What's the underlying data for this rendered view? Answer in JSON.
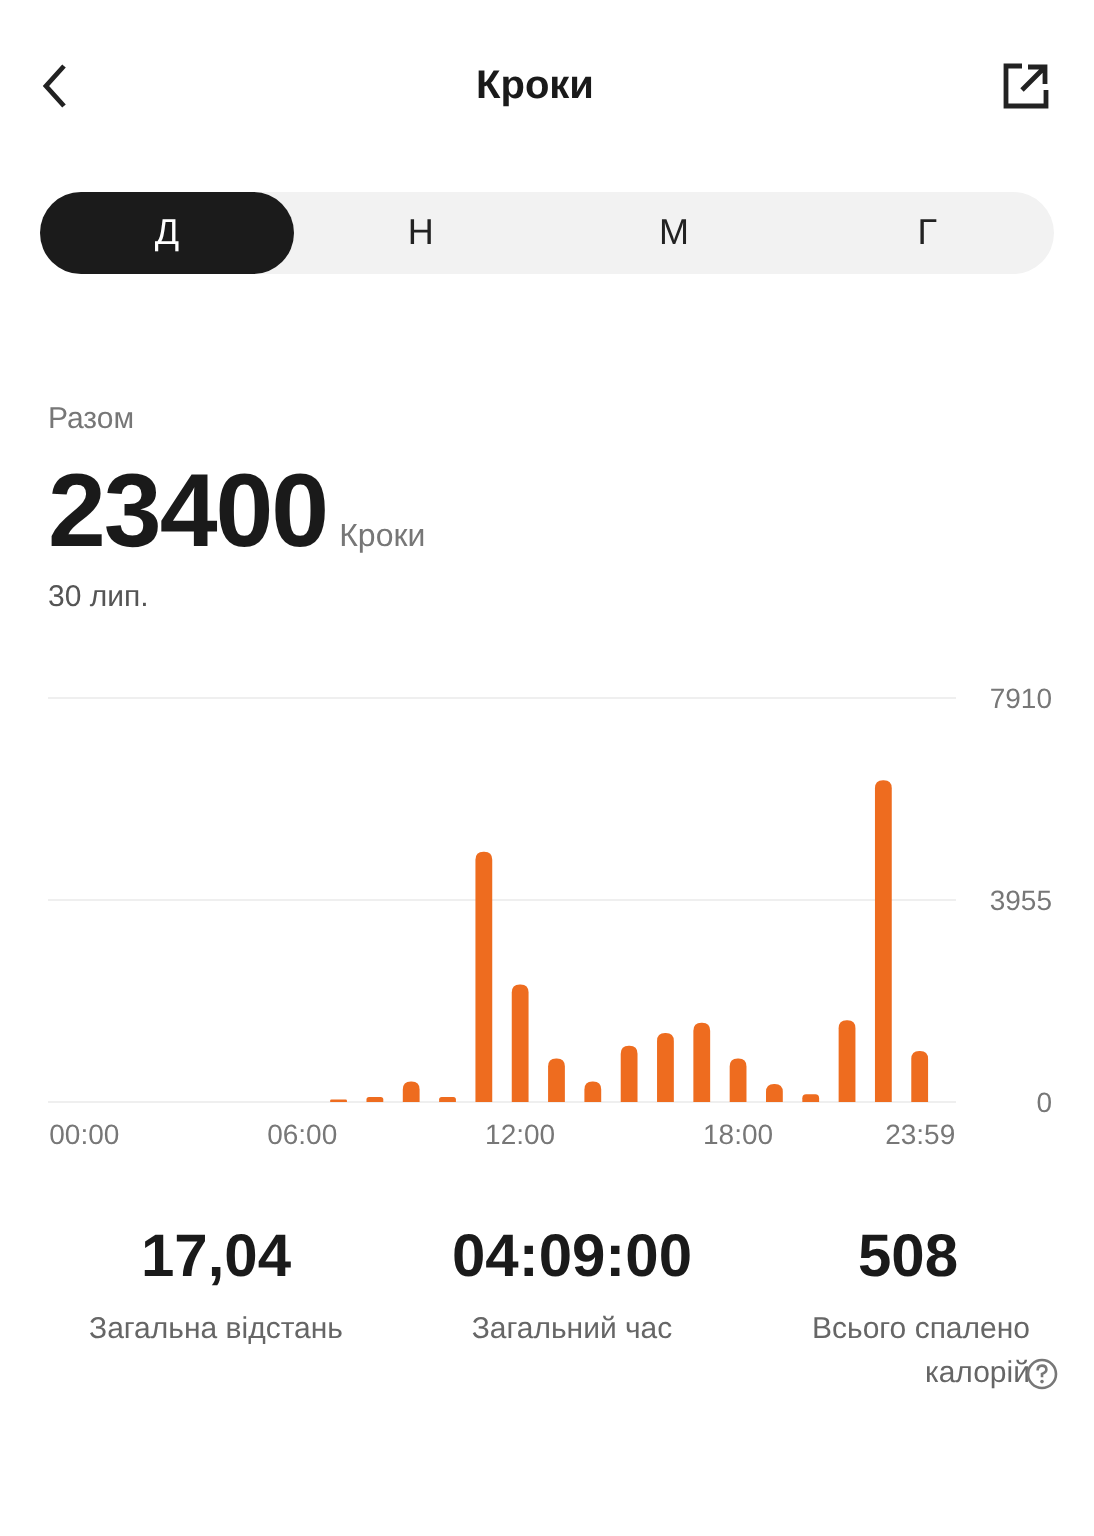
{
  "header": {
    "title": "Кроки"
  },
  "tabs": [
    {
      "label": "Д",
      "selected": true
    },
    {
      "label": "Н",
      "selected": false
    },
    {
      "label": "М",
      "selected": false
    },
    {
      "label": "Г",
      "selected": false
    }
  ],
  "summary": {
    "label": "Разом",
    "value": "23400",
    "unit": "Кроки",
    "date": "30 лип."
  },
  "chart": {
    "chart_data": {
      "type": "bar",
      "x": [
        7,
        8,
        9,
        10,
        11,
        12,
        13,
        14,
        15,
        16,
        17,
        18,
        19,
        20,
        21,
        22,
        23
      ],
      "values": [
        50,
        100,
        400,
        100,
        4900,
        2300,
        850,
        400,
        1100,
        1350,
        1550,
        850,
        350,
        150,
        1600,
        6300,
        1000
      ],
      "xlim": [
        -1,
        24
      ],
      "ylim": [
        0,
        7910
      ],
      "yticks": [
        0,
        3955,
        7910
      ],
      "xticks": [
        {
          "value": 0,
          "label": "00:00"
        },
        {
          "value": 6,
          "label": "06:00"
        },
        {
          "value": 12,
          "label": "12:00"
        },
        {
          "value": 18,
          "label": "18:00"
        },
        {
          "value": 23.98,
          "label": "23:59"
        }
      ]
    }
  },
  "stats": [
    {
      "value": "17,04",
      "label": "Загальна відстань",
      "info": false
    },
    {
      "value": "04:09:00",
      "label": "Загальний час",
      "info": false
    },
    {
      "value": "508",
      "label": "Всього спалено калорій",
      "info": true
    }
  ]
}
